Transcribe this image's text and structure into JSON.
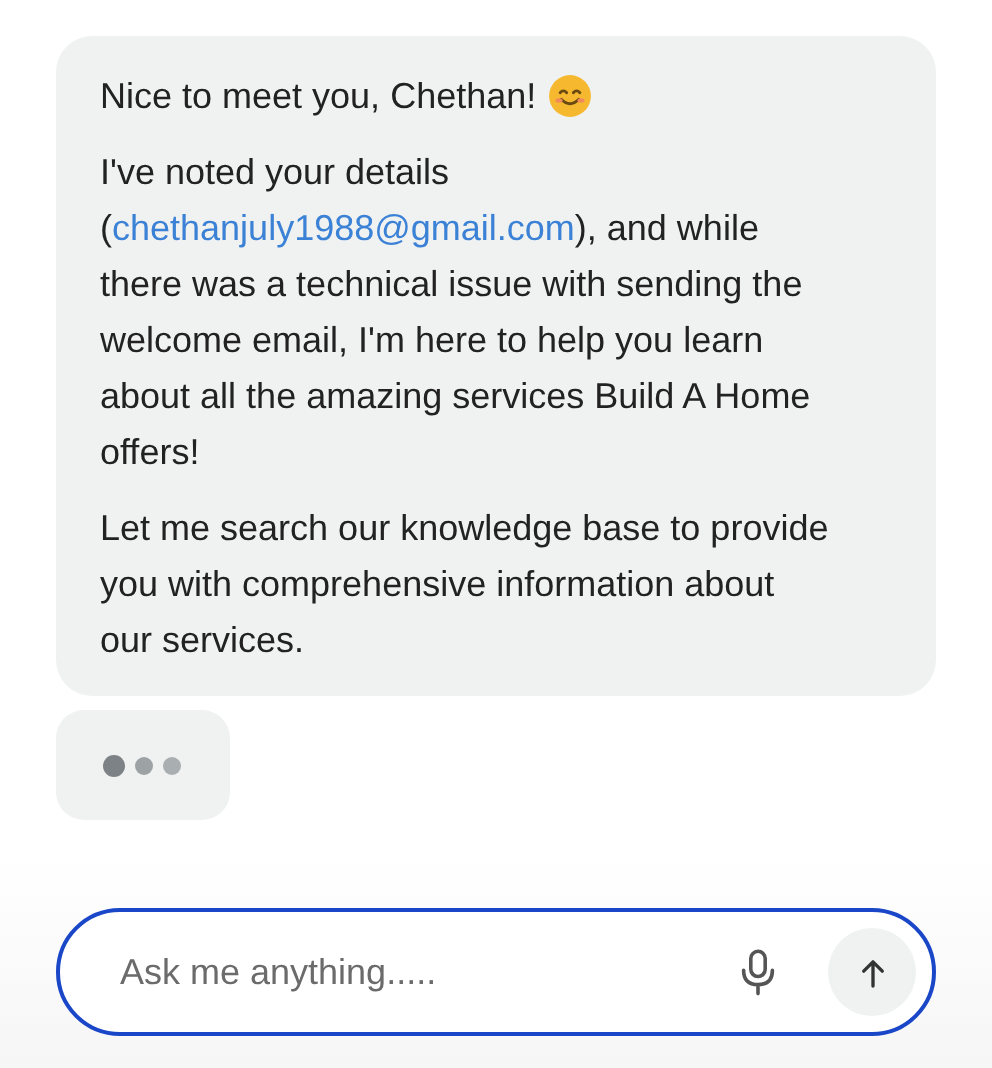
{
  "message": {
    "greeting": "Nice to meet you, Chethan!",
    "details": {
      "before": "I've noted your details (",
      "link": "chethanjuly1988@gmail.com",
      "after": "), and while there was a technical issue with sending the welcome email, I'm here to help you learn about all the amazing services Build A Home offers!"
    },
    "closing": "Let me search our knowledge base to provide you with comprehensive information about our services."
  },
  "typing": true,
  "composer": {
    "placeholder": "Ask me anything....."
  }
}
